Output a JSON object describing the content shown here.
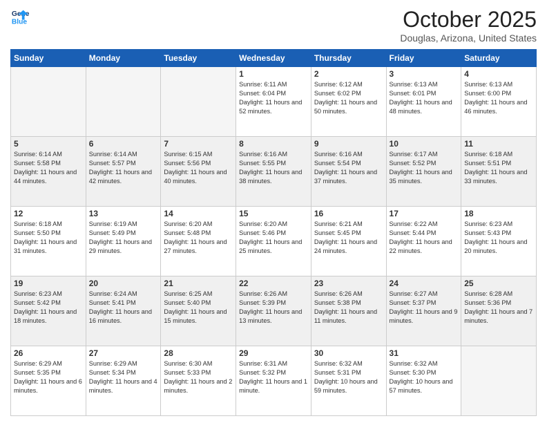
{
  "header": {
    "logo_general": "General",
    "logo_blue": "Blue",
    "month": "October 2025",
    "location": "Douglas, Arizona, United States"
  },
  "weekdays": [
    "Sunday",
    "Monday",
    "Tuesday",
    "Wednesday",
    "Thursday",
    "Friday",
    "Saturday"
  ],
  "weeks": [
    [
      {
        "day": "",
        "empty": true
      },
      {
        "day": "",
        "empty": true
      },
      {
        "day": "",
        "empty": true
      },
      {
        "day": "1",
        "sunrise": "Sunrise: 6:11 AM",
        "sunset": "Sunset: 6:04 PM",
        "daylight": "Daylight: 11 hours and 52 minutes."
      },
      {
        "day": "2",
        "sunrise": "Sunrise: 6:12 AM",
        "sunset": "Sunset: 6:02 PM",
        "daylight": "Daylight: 11 hours and 50 minutes."
      },
      {
        "day": "3",
        "sunrise": "Sunrise: 6:13 AM",
        "sunset": "Sunset: 6:01 PM",
        "daylight": "Daylight: 11 hours and 48 minutes."
      },
      {
        "day": "4",
        "sunrise": "Sunrise: 6:13 AM",
        "sunset": "Sunset: 6:00 PM",
        "daylight": "Daylight: 11 hours and 46 minutes."
      }
    ],
    [
      {
        "day": "5",
        "sunrise": "Sunrise: 6:14 AM",
        "sunset": "Sunset: 5:58 PM",
        "daylight": "Daylight: 11 hours and 44 minutes."
      },
      {
        "day": "6",
        "sunrise": "Sunrise: 6:14 AM",
        "sunset": "Sunset: 5:57 PM",
        "daylight": "Daylight: 11 hours and 42 minutes."
      },
      {
        "day": "7",
        "sunrise": "Sunrise: 6:15 AM",
        "sunset": "Sunset: 5:56 PM",
        "daylight": "Daylight: 11 hours and 40 minutes."
      },
      {
        "day": "8",
        "sunrise": "Sunrise: 6:16 AM",
        "sunset": "Sunset: 5:55 PM",
        "daylight": "Daylight: 11 hours and 38 minutes."
      },
      {
        "day": "9",
        "sunrise": "Sunrise: 6:16 AM",
        "sunset": "Sunset: 5:54 PM",
        "daylight": "Daylight: 11 hours and 37 minutes."
      },
      {
        "day": "10",
        "sunrise": "Sunrise: 6:17 AM",
        "sunset": "Sunset: 5:52 PM",
        "daylight": "Daylight: 11 hours and 35 minutes."
      },
      {
        "day": "11",
        "sunrise": "Sunrise: 6:18 AM",
        "sunset": "Sunset: 5:51 PM",
        "daylight": "Daylight: 11 hours and 33 minutes."
      }
    ],
    [
      {
        "day": "12",
        "sunrise": "Sunrise: 6:18 AM",
        "sunset": "Sunset: 5:50 PM",
        "daylight": "Daylight: 11 hours and 31 minutes."
      },
      {
        "day": "13",
        "sunrise": "Sunrise: 6:19 AM",
        "sunset": "Sunset: 5:49 PM",
        "daylight": "Daylight: 11 hours and 29 minutes."
      },
      {
        "day": "14",
        "sunrise": "Sunrise: 6:20 AM",
        "sunset": "Sunset: 5:48 PM",
        "daylight": "Daylight: 11 hours and 27 minutes."
      },
      {
        "day": "15",
        "sunrise": "Sunrise: 6:20 AM",
        "sunset": "Sunset: 5:46 PM",
        "daylight": "Daylight: 11 hours and 25 minutes."
      },
      {
        "day": "16",
        "sunrise": "Sunrise: 6:21 AM",
        "sunset": "Sunset: 5:45 PM",
        "daylight": "Daylight: 11 hours and 24 minutes."
      },
      {
        "day": "17",
        "sunrise": "Sunrise: 6:22 AM",
        "sunset": "Sunset: 5:44 PM",
        "daylight": "Daylight: 11 hours and 22 minutes."
      },
      {
        "day": "18",
        "sunrise": "Sunrise: 6:23 AM",
        "sunset": "Sunset: 5:43 PM",
        "daylight": "Daylight: 11 hours and 20 minutes."
      }
    ],
    [
      {
        "day": "19",
        "sunrise": "Sunrise: 6:23 AM",
        "sunset": "Sunset: 5:42 PM",
        "daylight": "Daylight: 11 hours and 18 minutes."
      },
      {
        "day": "20",
        "sunrise": "Sunrise: 6:24 AM",
        "sunset": "Sunset: 5:41 PM",
        "daylight": "Daylight: 11 hours and 16 minutes."
      },
      {
        "day": "21",
        "sunrise": "Sunrise: 6:25 AM",
        "sunset": "Sunset: 5:40 PM",
        "daylight": "Daylight: 11 hours and 15 minutes."
      },
      {
        "day": "22",
        "sunrise": "Sunrise: 6:26 AM",
        "sunset": "Sunset: 5:39 PM",
        "daylight": "Daylight: 11 hours and 13 minutes."
      },
      {
        "day": "23",
        "sunrise": "Sunrise: 6:26 AM",
        "sunset": "Sunset: 5:38 PM",
        "daylight": "Daylight: 11 hours and 11 minutes."
      },
      {
        "day": "24",
        "sunrise": "Sunrise: 6:27 AM",
        "sunset": "Sunset: 5:37 PM",
        "daylight": "Daylight: 11 hours and 9 minutes."
      },
      {
        "day": "25",
        "sunrise": "Sunrise: 6:28 AM",
        "sunset": "Sunset: 5:36 PM",
        "daylight": "Daylight: 11 hours and 7 minutes."
      }
    ],
    [
      {
        "day": "26",
        "sunrise": "Sunrise: 6:29 AM",
        "sunset": "Sunset: 5:35 PM",
        "daylight": "Daylight: 11 hours and 6 minutes."
      },
      {
        "day": "27",
        "sunrise": "Sunrise: 6:29 AM",
        "sunset": "Sunset: 5:34 PM",
        "daylight": "Daylight: 11 hours and 4 minutes."
      },
      {
        "day": "28",
        "sunrise": "Sunrise: 6:30 AM",
        "sunset": "Sunset: 5:33 PM",
        "daylight": "Daylight: 11 hours and 2 minutes."
      },
      {
        "day": "29",
        "sunrise": "Sunrise: 6:31 AM",
        "sunset": "Sunset: 5:32 PM",
        "daylight": "Daylight: 11 hours and 1 minute."
      },
      {
        "day": "30",
        "sunrise": "Sunrise: 6:32 AM",
        "sunset": "Sunset: 5:31 PM",
        "daylight": "Daylight: 10 hours and 59 minutes."
      },
      {
        "day": "31",
        "sunrise": "Sunrise: 6:32 AM",
        "sunset": "Sunset: 5:30 PM",
        "daylight": "Daylight: 10 hours and 57 minutes."
      },
      {
        "day": "",
        "empty": true
      }
    ]
  ]
}
